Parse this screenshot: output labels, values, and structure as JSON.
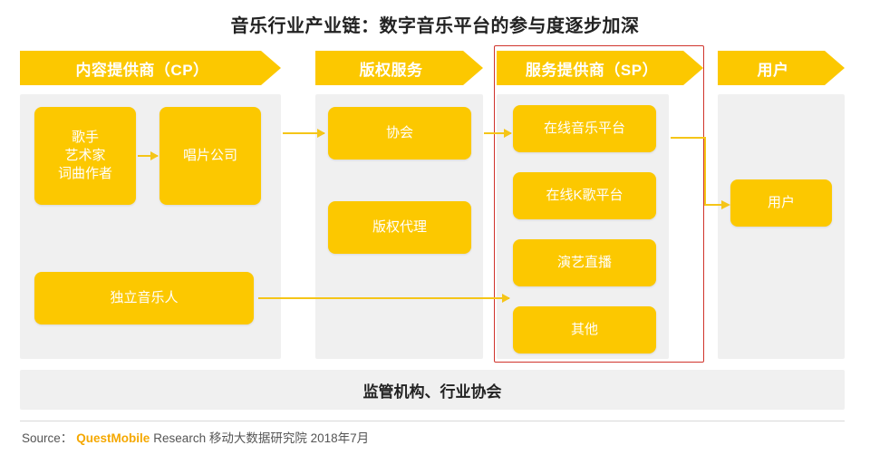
{
  "title": "音乐行业产业链：数字音乐平台的参与度逐步加深",
  "stages": [
    {
      "id": "cp",
      "label": "内容提供商（CP）"
    },
    {
      "id": "cr",
      "label": "版权服务"
    },
    {
      "id": "sp",
      "label": "服务提供商（SP）"
    },
    {
      "id": "user",
      "label": "用户"
    }
  ],
  "nodes": {
    "artist_line1": "歌手",
    "artist_line2": "艺术家",
    "artist_line3": "词曲作者",
    "record_company": "唱片公司",
    "independent_musician": "独立音乐人",
    "association": "协会",
    "copyright_agency": "版权代理",
    "online_music_platform": "在线音乐平台",
    "online_ktv_platform": "在线K歌平台",
    "live_performance": "演艺直播",
    "other": "其他",
    "user": "用户"
  },
  "bottom_bar": "监管机构、行业协会",
  "source": {
    "label": "Source：",
    "brand": "QuestMobile",
    "rest": "Research 移动大数据研究院 2018年7月"
  },
  "colors": {
    "accent_yellow": "#FCC800",
    "arrow_yellow": "#F5C518",
    "panel_gray": "#f0f0f0",
    "highlight_red": "#d0342c",
    "brand_orange": "#F5A800"
  }
}
